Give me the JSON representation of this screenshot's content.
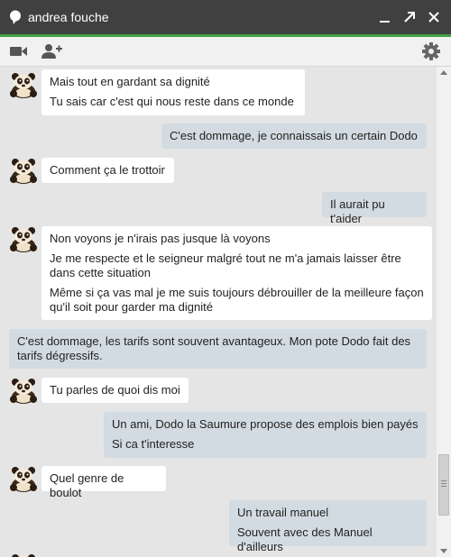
{
  "window": {
    "title": "andrea fouche",
    "accent_color": "#43a047",
    "icons": [
      "chat-bubble-icon",
      "minimize-icon",
      "popout-icon",
      "close-icon"
    ]
  },
  "toolbar": {
    "icons": [
      "video-call-icon",
      "add-person-icon",
      "settings-icon"
    ]
  },
  "messages": [
    {
      "direction": "incoming",
      "lines": [
        "Mais tout en gardant sa dignité",
        "Tu sais car c'est qui nous reste dans ce monde"
      ]
    },
    {
      "direction": "outgoing",
      "lines": [
        "C'est dommage, je connaissais un certain Dodo"
      ]
    },
    {
      "direction": "incoming",
      "lines": [
        "Comment ça le trottoir"
      ]
    },
    {
      "direction": "outgoing",
      "lines": [
        "Il aurait pu t'aider"
      ]
    },
    {
      "direction": "incoming",
      "lines": [
        "Non voyons je n'irais pas jusque là voyons",
        "Je me respecte et le seigneur malgré tout ne m'a jamais laisser être dans cette situation",
        "Même si ça vas mal je me suis toujours débrouiller de la meilleure façon qu'il soit pour garder ma dignité"
      ]
    },
    {
      "direction": "outgoing",
      "lines": [
        "C'est dommage, les tarifs sont souvent avantageux. Mon pote Dodo fait des tarifs dégressifs."
      ]
    },
    {
      "direction": "incoming",
      "lines": [
        "Tu parles de quoi dis moi"
      ]
    },
    {
      "direction": "outgoing",
      "lines": [
        "Un ami, Dodo la Saumure propose des emplois bien payés",
        "Si ca t'interesse"
      ]
    },
    {
      "direction": "incoming",
      "lines": [
        "Quel genre de boulot"
      ]
    },
    {
      "direction": "outgoing",
      "lines": [
        "Un travail manuel",
        "Souvent avec des Manuel d'ailleurs"
      ]
    }
  ]
}
